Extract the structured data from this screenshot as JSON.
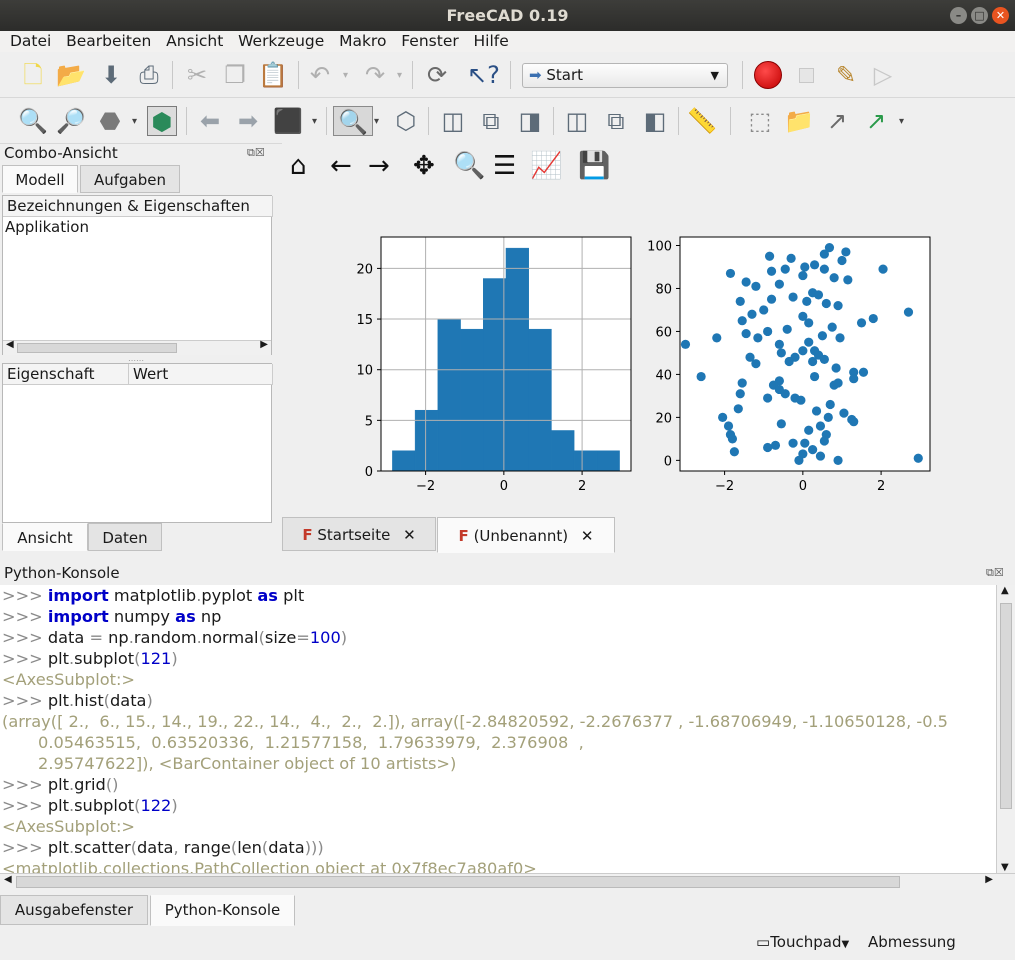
{
  "window": {
    "title": "FreeCAD 0.19"
  },
  "menu": [
    "Datei",
    "Bearbeiten",
    "Ansicht",
    "Werkzeuge",
    "Makro",
    "Fenster",
    "Hilfe"
  ],
  "workbench": {
    "selected": "Start"
  },
  "combo": {
    "title": "Combo-Ansicht",
    "tabs": [
      "Modell",
      "Aufgaben"
    ],
    "tree_header": "Bezeichnungen & Eigenschaften",
    "tree_items": [
      "Applikation"
    ],
    "prop_headers": [
      "Eigenschaft",
      "Wert"
    ],
    "bottom_tabs": [
      "Ansicht",
      "Daten"
    ]
  },
  "doc_tabs": [
    "Startseite",
    "(Unbenannt)"
  ],
  "console": {
    "title": "Python-Konsole",
    "prompt": ">>>",
    "lines": [
      {
        "kind": "in",
        "text": "import matplotlib.pyplot as plt"
      },
      {
        "kind": "in",
        "text": "import numpy as np"
      },
      {
        "kind": "in",
        "text": "data = np.random.normal(size=100)"
      },
      {
        "kind": "in",
        "text": "plt.subplot(121)"
      },
      {
        "kind": "out",
        "text": "<AxesSubplot:>"
      },
      {
        "kind": "in",
        "text": "plt.hist(data)"
      },
      {
        "kind": "out",
        "text": "(array([ 2.,  6., 15., 14., 19., 22., 14.,  4.,  2.,  2.]), array([-2.84820592, -2.2676377 , -1.68706949, -1.10650128, -0.5"
      },
      {
        "kind": "out",
        "text": "       0.05463515,  0.63520336,  1.21577158,  1.79633979,  2.376908  ,"
      },
      {
        "kind": "out",
        "text": "       2.95747622]), <BarContainer object of 10 artists>)"
      },
      {
        "kind": "in",
        "text": "plt.grid()"
      },
      {
        "kind": "in",
        "text": "plt.subplot(122)"
      },
      {
        "kind": "out",
        "text": "<AxesSubplot:>"
      },
      {
        "kind": "in",
        "text": "plt.scatter(data, range(len(data)))"
      },
      {
        "kind": "out",
        "text": "<matplotlib.collections.PathCollection object at 0x7f8ec7a80af0>"
      }
    ]
  },
  "bottom_tabs": [
    "Ausgabefenster",
    "Python-Konsole"
  ],
  "status": {
    "touchpad": "Touchpad",
    "unit": "Abmessung"
  },
  "chart_data": [
    {
      "type": "bar",
      "grid": true,
      "bin_edges": [
        -2.84820592,
        -2.2676377,
        -1.68706949,
        -1.10650128,
        -0.52593307,
        0.05463515,
        0.63520336,
        1.21577158,
        1.79633979,
        2.376908,
        2.95747622
      ],
      "values": [
        2,
        6,
        15,
        14,
        19,
        22,
        14,
        4,
        2,
        2
      ],
      "xlim": [
        -3.14,
        3.25
      ],
      "ylim": [
        0,
        23.1
      ],
      "xticks": [
        -2,
        0,
        2
      ],
      "yticks": [
        0,
        5,
        10,
        15,
        20
      ]
    },
    {
      "type": "scatter",
      "color": "#1f77b4",
      "xlim": [
        -3.14,
        3.25
      ],
      "ylim": [
        -4.95,
        103.95
      ],
      "xticks": [
        -2,
        0,
        2
      ],
      "yticks": [
        0,
        20,
        40,
        60,
        80,
        100
      ],
      "points": [
        [
          0.68,
          99
        ],
        [
          1.1,
          97
        ],
        [
          0.55,
          96
        ],
        [
          -0.85,
          95
        ],
        [
          -0.3,
          94
        ],
        [
          1.0,
          93
        ],
        [
          0.3,
          91
        ],
        [
          0.05,
          90
        ],
        [
          -0.45,
          89
        ],
        [
          2.05,
          89
        ],
        [
          0.55,
          89
        ],
        [
          -0.8,
          88
        ],
        [
          -1.85,
          87
        ],
        [
          0.0,
          86
        ],
        [
          0.8,
          85
        ],
        [
          1.15,
          84
        ],
        [
          -1.45,
          83
        ],
        [
          -0.6,
          82
        ],
        [
          -1.2,
          81
        ],
        [
          0.25,
          78
        ],
        [
          0.4,
          77
        ],
        [
          -0.25,
          76
        ],
        [
          -0.8,
          75
        ],
        [
          -1.6,
          74
        ],
        [
          0.1,
          74
        ],
        [
          0.6,
          73
        ],
        [
          0.9,
          72
        ],
        [
          -1.0,
          70
        ],
        [
          -1.3,
          68
        ],
        [
          2.7,
          69
        ],
        [
          0.0,
          67
        ],
        [
          0.15,
          64
        ],
        [
          1.8,
          66
        ],
        [
          -1.55,
          65
        ],
        [
          0.75,
          62
        ],
        [
          -0.4,
          61
        ],
        [
          -0.9,
          60
        ],
        [
          1.5,
          64
        ],
        [
          -1.45,
          59
        ],
        [
          0.5,
          58
        ],
        [
          0.95,
          57
        ],
        [
          -1.15,
          57
        ],
        [
          -3.0,
          54
        ],
        [
          0.15,
          55
        ],
        [
          -0.6,
          54
        ],
        [
          -2.2,
          57
        ],
        [
          0.3,
          51
        ],
        [
          -0.55,
          50
        ],
        [
          0.0,
          51
        ],
        [
          0.4,
          49
        ],
        [
          -1.35,
          48
        ],
        [
          -0.2,
          48
        ],
        [
          -0.35,
          46
        ],
        [
          0.55,
          47
        ],
        [
          -1.2,
          45
        ],
        [
          0.25,
          46
        ],
        [
          1.3,
          41
        ],
        [
          0.85,
          43
        ],
        [
          1.55,
          41
        ],
        [
          -2.6,
          39
        ],
        [
          0.3,
          39
        ],
        [
          -0.6,
          37
        ],
        [
          0.8,
          35
        ],
        [
          0.9,
          36
        ],
        [
          1.3,
          38
        ],
        [
          -1.55,
          36
        ],
        [
          -0.75,
          35
        ],
        [
          -0.6,
          33
        ],
        [
          -0.45,
          31
        ],
        [
          -0.9,
          29
        ],
        [
          -0.2,
          29
        ],
        [
          -1.6,
          31
        ],
        [
          -0.05,
          28
        ],
        [
          0.7,
          26
        ],
        [
          -1.65,
          24
        ],
        [
          0.35,
          23
        ],
        [
          1.05,
          22
        ],
        [
          0.65,
          20
        ],
        [
          -2.05,
          20
        ],
        [
          1.25,
          19
        ],
        [
          1.3,
          18
        ],
        [
          -1.9,
          16
        ],
        [
          0.45,
          16
        ],
        [
          0.15,
          14
        ],
        [
          -1.85,
          12
        ],
        [
          0.6,
          12
        ],
        [
          -1.8,
          10
        ],
        [
          0.05,
          8
        ],
        [
          -0.7,
          7
        ],
        [
          -0.9,
          6
        ],
        [
          0.25,
          5
        ],
        [
          -1.75,
          4
        ],
        [
          0.0,
          3
        ],
        [
          0.45,
          2
        ],
        [
          2.95,
          1
        ],
        [
          0.9,
          0
        ],
        [
          -0.1,
          0
        ],
        [
          -0.25,
          8
        ],
        [
          0.55,
          9
        ],
        [
          -0.55,
          17
        ]
      ]
    }
  ]
}
